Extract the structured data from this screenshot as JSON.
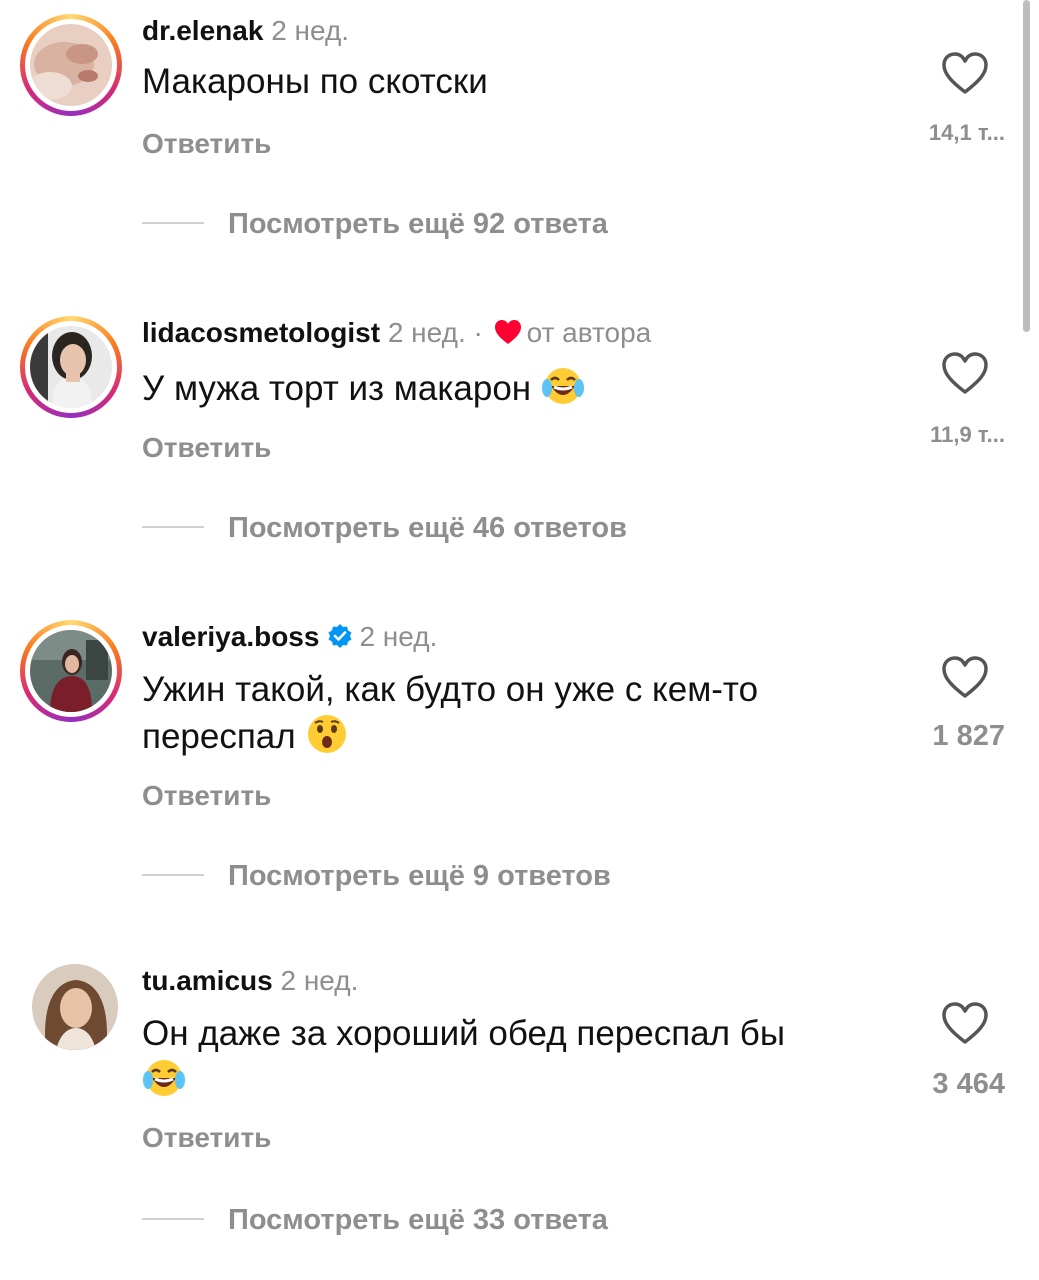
{
  "comments": [
    {
      "username": "dr.elenak",
      "time": "2 нед.",
      "text": "Макароны по скотски",
      "reply_label": "Ответить",
      "like_count": "14,1 т...",
      "more_replies": "Посмотреть ещё 92 ответа"
    },
    {
      "username": "lidacosmetologist",
      "time": "2 нед.",
      "separator": "·",
      "author_like_label": "от автора",
      "text": "У мужа торт из макарон",
      "emoji": "face-with-tears-of-joy",
      "reply_label": "Ответить",
      "like_count": "11,9 т...",
      "more_replies": "Посмотреть ещё 46 ответов"
    },
    {
      "username": "valeriya.boss",
      "verified": true,
      "time": "2 нед.",
      "text_line1": "Ужин такой, как будто он уже с кем-то",
      "text_line2": "переспал",
      "emoji": "hushed-face",
      "reply_label": "Ответить",
      "like_count": "1 827",
      "more_replies": "Посмотреть ещё 9 ответов"
    },
    {
      "username": "tu.amicus",
      "time": "2 нед.",
      "text": "Он даже за хороший обед переспал бы",
      "emoji": "face-with-tears-of-joy",
      "reply_label": "Ответить",
      "like_count": "3 464",
      "more_replies": "Посмотреть ещё 33 ответа"
    }
  ],
  "colors": {
    "text": "#111111",
    "muted": "#8e8e8e",
    "author_heart": "#ff0033",
    "verified": "#0095f6",
    "story_ring": [
      "#feda75",
      "#fa7e1e",
      "#d62976",
      "#962fbf"
    ]
  }
}
